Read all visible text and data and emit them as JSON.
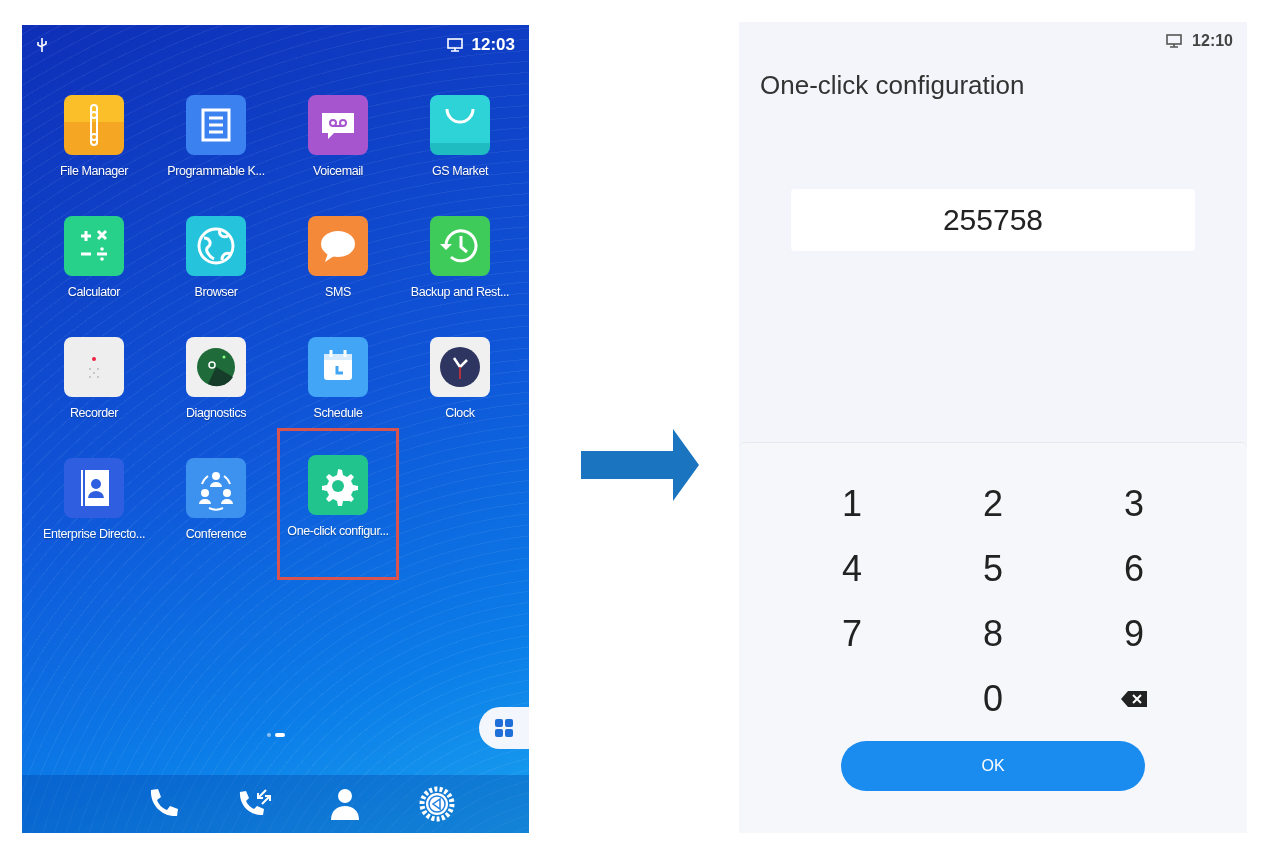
{
  "home_screen": {
    "status_bar": {
      "time": "12:03"
    },
    "apps": [
      {
        "label": "File Manager",
        "highlighted": false
      },
      {
        "label": "Programmable K...",
        "highlighted": false
      },
      {
        "label": "Voicemail",
        "highlighted": false
      },
      {
        "label": "GS Market",
        "highlighted": false
      },
      {
        "label": "Calculator",
        "highlighted": false
      },
      {
        "label": "Browser",
        "highlighted": false
      },
      {
        "label": "SMS",
        "highlighted": false
      },
      {
        "label": "Backup and Rest...",
        "highlighted": false
      },
      {
        "label": "Recorder",
        "highlighted": false
      },
      {
        "label": "Diagnostics",
        "highlighted": false
      },
      {
        "label": "Schedule",
        "highlighted": false
      },
      {
        "label": "Clock",
        "highlighted": false
      },
      {
        "label": "Enterprise Directo...",
        "highlighted": false
      },
      {
        "label": "Conference",
        "highlighted": false
      },
      {
        "label": "One-click configur...",
        "highlighted": true
      }
    ],
    "page_dots": [
      {
        "selected": false
      },
      {
        "selected": true
      }
    ]
  },
  "config_screen": {
    "status_bar": {
      "time": "12:10"
    },
    "title": "One-click configuration",
    "code_field": {
      "value": "255758"
    },
    "keys": [
      {
        "kind": "digit",
        "label": "1"
      },
      {
        "kind": "digit",
        "label": "2"
      },
      {
        "kind": "digit",
        "label": "3"
      },
      {
        "kind": "digit",
        "label": "4"
      },
      {
        "kind": "digit",
        "label": "5"
      },
      {
        "kind": "digit",
        "label": "6"
      },
      {
        "kind": "digit",
        "label": "7"
      },
      {
        "kind": "digit",
        "label": "8"
      },
      {
        "kind": "digit",
        "label": "9"
      },
      {
        "kind": "blank"
      },
      {
        "kind": "digit",
        "label": "0"
      },
      {
        "kind": "backspace"
      }
    ],
    "ok_button": "OK"
  }
}
